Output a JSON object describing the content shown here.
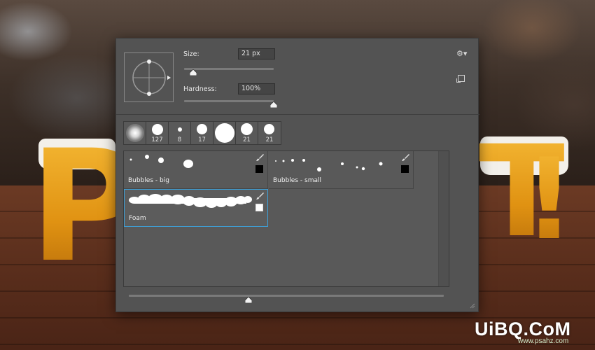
{
  "watermark": {
    "main": "UiBQ.CoM",
    "sub": "www.psahz.com"
  },
  "brush_settings": {
    "size_label": "Size:",
    "size_value": "21 px",
    "size_fraction": 0.1,
    "hardness_label": "Hardness:",
    "hardness_value": "100%",
    "hardness_fraction": 1.0
  },
  "icons": {
    "menu": "gear-icon",
    "new_preset": "new-preset-icon",
    "brush": "brush-icon"
  },
  "brush_tips": [
    {
      "number": "",
      "kind": "soft"
    },
    {
      "number": "127",
      "kind": "hard"
    },
    {
      "number": "8",
      "kind": "hard"
    },
    {
      "number": "17",
      "kind": "hard"
    },
    {
      "number": "",
      "kind": "hard"
    },
    {
      "number": "21",
      "kind": "hard"
    },
    {
      "number": "21",
      "kind": "hard"
    }
  ],
  "presets": [
    {
      "name": "Bubbles - big",
      "swatch": "#000000",
      "selected": false
    },
    {
      "name": "Bubbles - small",
      "swatch": "#000000",
      "selected": false
    },
    {
      "name": "Foam",
      "swatch": "#ffffff",
      "selected": true
    }
  ],
  "thumbnail_size_fraction": 0.38
}
